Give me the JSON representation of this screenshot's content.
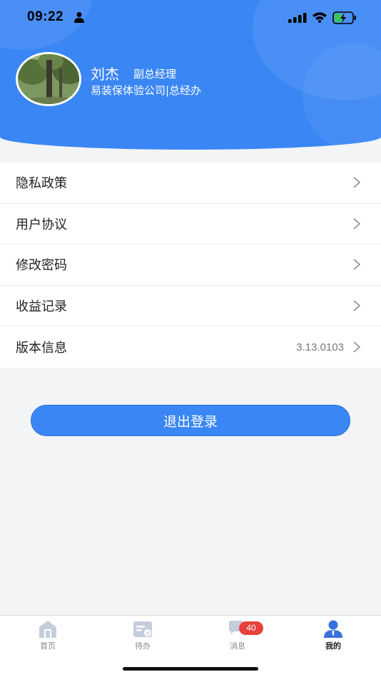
{
  "status_bar": {
    "time": "09:22"
  },
  "profile": {
    "name": "刘杰",
    "role": "副总经理",
    "organization": "易装保体验公司|总经办"
  },
  "menu": {
    "items": [
      {
        "label": "隐私政策",
        "value": ""
      },
      {
        "label": "用户协议",
        "value": ""
      },
      {
        "label": "修改密码",
        "value": ""
      },
      {
        "label": "收益记录",
        "value": ""
      },
      {
        "label": "版本信息",
        "value": "3.13.0103"
      }
    ]
  },
  "logout": {
    "label": "退出登录"
  },
  "tabbar": {
    "tabs": [
      {
        "label": "首页",
        "icon": "home-icon"
      },
      {
        "label": "待办",
        "icon": "todo-icon"
      },
      {
        "label": "消息",
        "icon": "message-icon",
        "badge": "40"
      },
      {
        "label": "我的",
        "icon": "profile-icon",
        "active": true
      }
    ]
  },
  "colors": {
    "primary": "#3a86f5",
    "badge": "#e8403a",
    "background": "#f3f4f6"
  }
}
